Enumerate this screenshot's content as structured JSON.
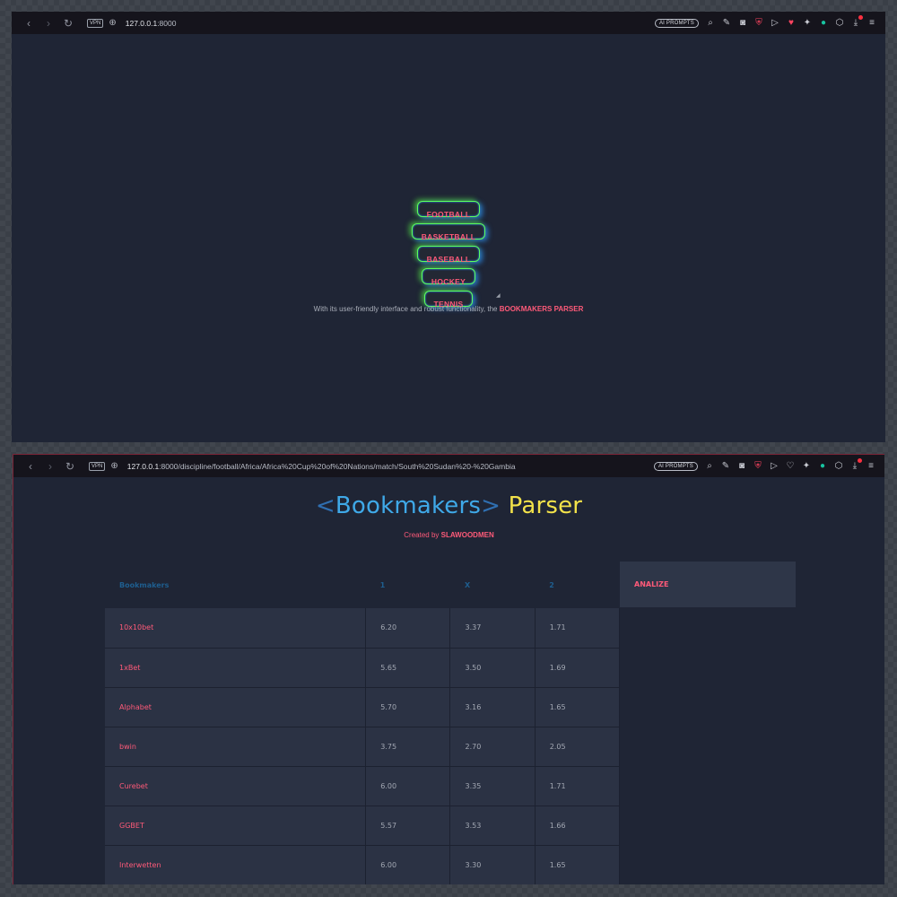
{
  "window1": {
    "url_host": "127.0.0.1",
    "url_rest": ":8000",
    "vpn_label": "VPN",
    "ai_prompts": "AI PROMPTS",
    "disciplines": [
      "FOOTBALL",
      "BASKETBALL",
      "BASEBALL",
      "HOCKEY",
      "TENNIS"
    ],
    "tagline_text": "With its user-friendly interface and robust functionality, the ",
    "tagline_emph": "BOOKMAKERS PARSER"
  },
  "window2": {
    "url_host": "127.0.0.1",
    "url_rest": ":8000/discipline/football/Africa/Africa%20Cup%20of%20Nations/match/South%20Sudan%20-%20Gambia",
    "vpn_label": "VPN",
    "ai_prompts": "AI PROMPTS",
    "brand_lt": "<",
    "brand_bk": "Bookmakers",
    "brand_gt": ">",
    "brand_ps": " Parser",
    "created_by": "Created by ",
    "creator": "SLAWOODMEN",
    "analize_label": "ANALIZE",
    "table": {
      "headers": [
        "Bookmakers",
        "1",
        "X",
        "2"
      ],
      "rows": [
        [
          "10x10bet",
          "6.20",
          "3.37",
          "1.71"
        ],
        [
          "1xBet",
          "5.65",
          "3.50",
          "1.69"
        ],
        [
          "Alphabet",
          "5.70",
          "3.16",
          "1.65"
        ],
        [
          "bwin",
          "3.75",
          "2.70",
          "2.05"
        ],
        [
          "Curebet",
          "6.00",
          "3.35",
          "1.71"
        ],
        [
          "GGBET",
          "5.57",
          "3.53",
          "1.66"
        ],
        [
          "Interwetten",
          "6.00",
          "3.30",
          "1.65"
        ]
      ]
    }
  },
  "icons": {
    "back": "‹",
    "forward": "›",
    "reload": "↻",
    "globe": "⊕"
  },
  "colors": {
    "accent_pink": "#ff5a79",
    "brand_blue": "#3fa9e8",
    "brand_yellow": "#f2e24a",
    "page_bg": "#1f2535"
  }
}
